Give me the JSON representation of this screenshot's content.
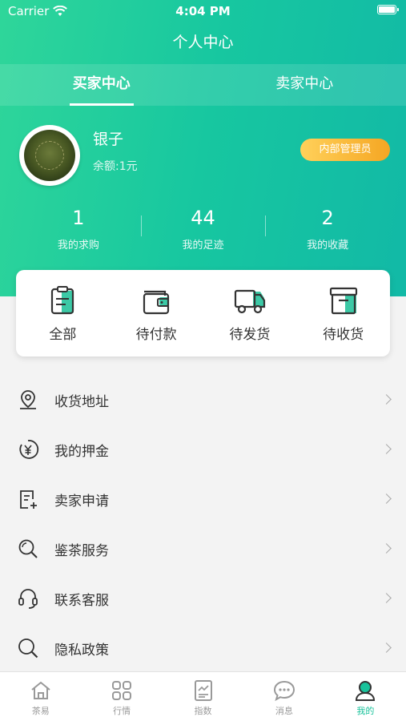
{
  "status_bar": {
    "carrier": "Carrier",
    "time": "4:04 PM"
  },
  "nav": {
    "title": "个人中心"
  },
  "tabs": [
    {
      "label": "买家中心",
      "active": true
    },
    {
      "label": "卖家中心",
      "active": false
    }
  ],
  "profile": {
    "name": "银子",
    "balance": "余额:1元",
    "badge": "内部管理员"
  },
  "stats": [
    {
      "value": "1",
      "label": "我的求购"
    },
    {
      "value": "44",
      "label": "我的足迹"
    },
    {
      "value": "2",
      "label": "我的收藏"
    }
  ],
  "orders": [
    {
      "label": "全部",
      "icon": "clipboard-icon"
    },
    {
      "label": "待付款",
      "icon": "wallet-icon"
    },
    {
      "label": "待发货",
      "icon": "truck-icon"
    },
    {
      "label": "待收货",
      "icon": "box-icon"
    }
  ],
  "menu": [
    {
      "label": "收货地址",
      "icon": "location-pin-icon"
    },
    {
      "label": "我的押金",
      "icon": "yen-coin-icon"
    },
    {
      "label": "卖家申请",
      "icon": "document-add-icon"
    },
    {
      "label": "鉴茶服务",
      "icon": "magnifier-icon"
    },
    {
      "label": "联系客服",
      "icon": "headset-icon"
    },
    {
      "label": "隐私政策",
      "icon": "search-icon"
    }
  ],
  "tabbar": [
    {
      "label": "茶易",
      "icon": "home-icon",
      "active": false
    },
    {
      "label": "行情",
      "icon": "grid-icon",
      "active": false
    },
    {
      "label": "指数",
      "icon": "chart-doc-icon",
      "active": false
    },
    {
      "label": "消息",
      "icon": "chat-bubble-icon",
      "active": false
    },
    {
      "label": "我的",
      "icon": "user-icon",
      "active": true
    }
  ],
  "colors": {
    "accent": "#19c29b",
    "badge": "#f5a623",
    "text": "#333333"
  }
}
